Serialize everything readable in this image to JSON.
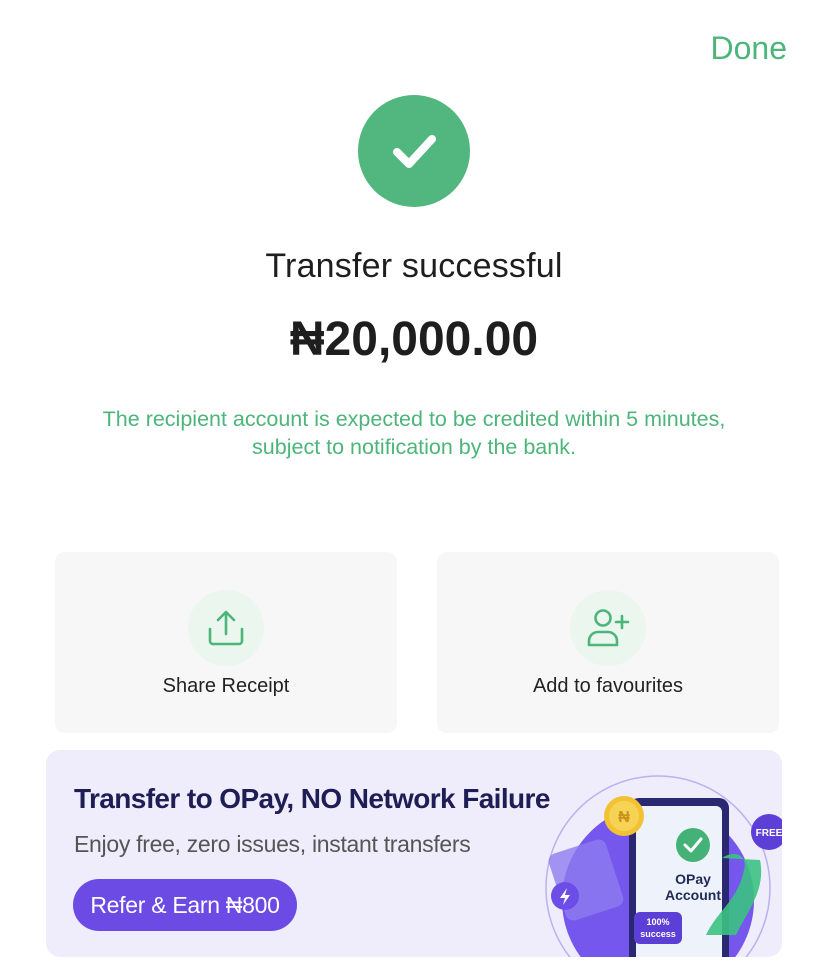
{
  "header": {
    "done_label": "Done"
  },
  "status": {
    "title": "Transfer successful",
    "amount": "₦20,000.00",
    "note_line1": "The recipient account is expected to be credited within 5 minutes,",
    "note_line2": "subject to notification by the bank."
  },
  "actions": [
    {
      "label": "Share Receipt",
      "icon": "share-upload-icon"
    },
    {
      "label": "Add to favourites",
      "icon": "add-user-icon"
    }
  ],
  "banner": {
    "title": "Transfer to OPay, NO Network Failure",
    "subtitle": "Enjoy free, zero issues, instant transfers",
    "button_label": "Refer & Earn ₦800",
    "art": {
      "phone_brand": "OPay",
      "phone_label": "Account",
      "badge_free": "FREE",
      "badge_success_1": "100%",
      "badge_success_2": "success",
      "coin_symbol": "₦"
    }
  },
  "colors": {
    "accent_green": "#4cb57a",
    "check_bg": "#52b77e",
    "banner_bg": "#efedfb",
    "banner_button": "#6c4be5",
    "banner_title": "#1f1d55"
  }
}
